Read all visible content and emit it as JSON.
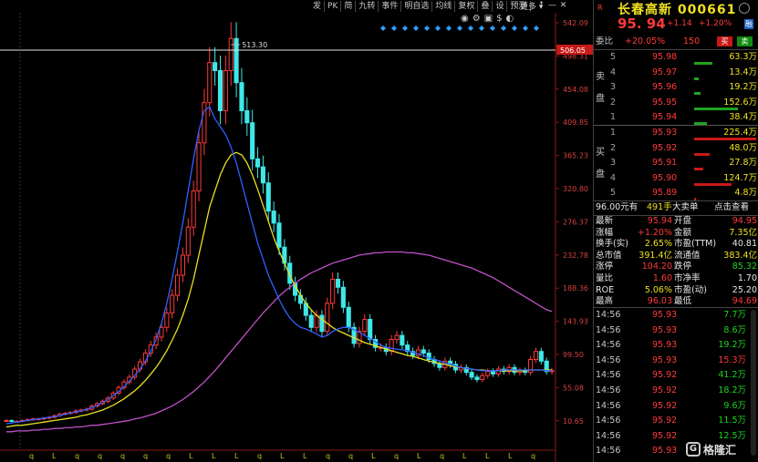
{
  "toolbar": {
    "items": [
      "发",
      "PK",
      "简",
      "九转",
      "事件",
      "明自选",
      "均线",
      "复权",
      "叠",
      "设",
      "预测"
    ],
    "more": "更多",
    "icons": [
      "eye-icon",
      "gear-icon",
      "lock-icon",
      "dollar-icon",
      "bell-icon"
    ],
    "window_controls": [
      "↑",
      "—",
      "✕"
    ]
  },
  "stock": {
    "badge": "R",
    "name": "长春高新 000661",
    "price": "95. 94",
    "change": "+1.14",
    "change_pct": "+1.20%",
    "margin_badge": "融",
    "weibi_label": "委比",
    "weibi_value": "+20.05%",
    "weibi_diff": "150",
    "buy_btn": "买",
    "sell_btn": "卖"
  },
  "order_book": {
    "sell_label": "卖\n盘",
    "buy_label": "买\n盘",
    "asks": [
      {
        "idx": "5",
        "price": "95.98",
        "vol": "63.3万",
        "bar": 0.3
      },
      {
        "idx": "4",
        "price": "95.97",
        "vol": "13.4万",
        "bar": 0.08
      },
      {
        "idx": "3",
        "price": "95.96",
        "vol": "19.2万",
        "bar": 0.1
      },
      {
        "idx": "2",
        "price": "95.95",
        "vol": "152.6万",
        "bar": 0.7
      },
      {
        "idx": "1",
        "price": "95.94",
        "vol": "38.4万",
        "bar": 0.2
      }
    ],
    "bids": [
      {
        "idx": "1",
        "price": "95.93",
        "vol": "225.4万",
        "bar": 1.0
      },
      {
        "idx": "2",
        "price": "95.92",
        "vol": "48.0万",
        "bar": 0.25
      },
      {
        "idx": "3",
        "price": "95.91",
        "vol": "27.8万",
        "bar": 0.15
      },
      {
        "idx": "4",
        "price": "95.90",
        "vol": "124.7万",
        "bar": 0.6
      },
      {
        "idx": "5",
        "price": "95.89",
        "vol": "4.8万",
        "bar": 0.03
      }
    ]
  },
  "big_order": {
    "label_price": "96.00元有",
    "qty": "491手",
    "type": "大卖单",
    "link": "点击查看"
  },
  "quote": [
    {
      "l1": "最新",
      "v1": "95.94",
      "c1": "red",
      "l2": "开盘",
      "v2": "94.95",
      "c2": "red"
    },
    {
      "l1": "涨幅",
      "v1": "+1.20%",
      "c1": "red",
      "l2": "金额",
      "v2": "7.35亿",
      "c2": "yellow"
    },
    {
      "l1": "换手(实)",
      "v1": "2.65%",
      "c1": "yellow",
      "l2": "市盈(TTM)",
      "v2": "40.81",
      "c2": "white"
    },
    {
      "l1": "总市值",
      "v1": "391.4亿",
      "c1": "yellow",
      "l2": "流通值",
      "v2": "383.4亿",
      "c2": "yellow"
    },
    {
      "l1": "涨停",
      "v1": "104.20",
      "c1": "red",
      "l2": "跌停",
      "v2": "85.32",
      "c2": "green"
    },
    {
      "l1": "量比",
      "v1": "1.60",
      "c1": "red",
      "l2": "市净率",
      "v2": "1.70",
      "c2": "white"
    },
    {
      "l1": "ROE",
      "v1": "5.06%",
      "c1": "yellow",
      "l2": "市盈(动)",
      "v2": "25.20",
      "c2": "white"
    },
    {
      "l1": "最高",
      "v1": "96.03",
      "c1": "red",
      "l2": "最低",
      "v2": "94.69",
      "c2": "red"
    }
  ],
  "ticks": [
    {
      "time": "14:56",
      "price": "95.93",
      "vol": "7.7万",
      "vc": "green",
      "dir": "↓",
      "dc": "green"
    },
    {
      "time": "14:56",
      "price": "95.93",
      "vol": "8.6万",
      "vc": "green",
      "dir": "↓",
      "dc": "green"
    },
    {
      "time": "14:56",
      "price": "95.93",
      "vol": "19.2万",
      "vc": "green",
      "dir": "↓",
      "dc": "green"
    },
    {
      "time": "14:56",
      "price": "95.93",
      "vol": "15.3万",
      "vc": "red",
      "dir": "↑",
      "dc": "red"
    },
    {
      "time": "14:56",
      "price": "95.92",
      "vol": "41.2万",
      "vc": "green",
      "dir": "↓",
      "dc": "green"
    },
    {
      "time": "14:56",
      "price": "95.92",
      "vol": "18.2万",
      "vc": "green",
      "dir": "↓",
      "dc": "green"
    },
    {
      "time": "14:56",
      "price": "95.92",
      "vol": "9.6万",
      "vc": "green",
      "dir": "↓",
      "dc": "green"
    },
    {
      "time": "14:56",
      "price": "95.92",
      "vol": "11.5万",
      "vc": "green",
      "dir": "↓",
      "dc": "green"
    },
    {
      "time": "14:56",
      "price": "95.92",
      "vol": "12.5万",
      "vc": "green",
      "dir": "↓",
      "dc": "green"
    },
    {
      "time": "14:56",
      "price": "95.93",
      "vol": "",
      "vc": "green",
      "dir": "",
      "dc": "green"
    }
  ],
  "watermark": {
    "logo": "G",
    "text": "格隆汇"
  },
  "chart_data": {
    "type": "candlestick",
    "y_ticks": [
      "542.09",
      "498.31",
      "454.08",
      "409.85",
      "365.23",
      "320.80",
      "276.37",
      "232.78",
      "188.36",
      "143.93",
      "99.50",
      "55.08",
      "10.65"
    ],
    "y_range": [
      10.65,
      542.09
    ],
    "max_label": "513.30",
    "crosshair_price": "506.05",
    "bottom_markers": [
      "q",
      "L",
      "q",
      "q",
      "q",
      "q",
      "q",
      "L",
      "L",
      "L",
      "q",
      "L",
      "L",
      "q",
      "q",
      "L",
      "q",
      "L",
      "q",
      "L",
      "L",
      "L",
      "q"
    ],
    "close": [
      34,
      33,
      33,
      34,
      35,
      36,
      36,
      37,
      38,
      40,
      42,
      43,
      44,
      46,
      47,
      48,
      52,
      55,
      58,
      62,
      68,
      75,
      82,
      88,
      98,
      107,
      118,
      128,
      138,
      150,
      168,
      190,
      215,
      240,
      275,
      320,
      380,
      430,
      480,
      470,
      420,
      470,
      510,
      455,
      420,
      405,
      360,
      350,
      330,
      295,
      280,
      250,
      230,
      205,
      190,
      180,
      165,
      150,
      165,
      145,
      180,
      210,
      200,
      175,
      150,
      130,
      145,
      160,
      135,
      125,
      125,
      120,
      135,
      140,
      128,
      120,
      115,
      122,
      118,
      110,
      105,
      100,
      108,
      104,
      97,
      100,
      94,
      88,
      85,
      90,
      95,
      92,
      98,
      95,
      100,
      94,
      96,
      94,
      110,
      120,
      108,
      95,
      96
    ],
    "ma_blue": [
      30,
      31,
      32,
      33,
      34,
      35,
      36,
      37,
      38,
      39,
      40,
      42,
      43,
      45,
      46,
      48,
      50,
      53,
      56,
      60,
      65,
      70,
      76,
      83,
      90,
      98,
      108,
      120,
      135,
      155,
      180,
      210,
      245,
      280,
      320,
      360,
      395,
      420,
      425,
      410,
      400,
      390,
      375,
      355,
      330,
      305,
      280,
      255,
      235,
      215,
      200,
      185,
      172,
      162,
      155,
      150,
      148,
      145,
      142,
      138,
      140,
      145,
      148,
      150,
      150,
      147,
      144,
      140,
      136,
      132,
      128,
      125,
      124,
      123,
      122,
      121,
      119,
      117,
      115,
      112,
      110,
      108,
      106,
      104,
      102,
      100,
      99,
      98,
      97,
      96,
      96,
      96,
      96,
      97,
      97,
      97,
      97,
      97,
      97,
      97,
      97,
      96,
      96
    ],
    "ma_yellow": [
      26,
      27,
      28,
      28,
      29,
      30,
      31,
      32,
      33,
      34,
      35,
      36,
      37,
      38,
      40,
      41,
      43,
      45,
      47,
      50,
      53,
      57,
      61,
      66,
      71,
      77,
      84,
      92,
      100,
      110,
      121,
      134,
      148,
      165,
      185,
      210,
      240,
      270,
      300,
      320,
      340,
      355,
      365,
      368,
      365,
      355,
      340,
      322,
      302,
      282,
      262,
      245,
      230,
      215,
      202,
      190,
      180,
      172,
      165,
      160,
      155,
      150,
      146,
      143,
      140,
      137,
      134,
      131,
      129,
      127,
      125,
      123,
      121,
      119,
      117,
      115,
      114,
      112,
      110,
      108,
      107,
      105,
      104,
      102,
      101,
      100,
      99,
      98,
      97,
      97,
      96,
      96,
      96,
      96,
      96,
      96,
      96,
      96,
      97,
      97,
      97,
      97,
      97
    ],
    "ma_purple": [
      20,
      20,
      21,
      21,
      21,
      22,
      22,
      23,
      23,
      24,
      24,
      25,
      25,
      26,
      26,
      27,
      28,
      28,
      29,
      30,
      31,
      32,
      33,
      34,
      36,
      37,
      39,
      41,
      43,
      46,
      49,
      52,
      56,
      60,
      65,
      70,
      76,
      82,
      89,
      96,
      104,
      112,
      120,
      128,
      136,
      144,
      152,
      160,
      168,
      175,
      182,
      189,
      195,
      200,
      205,
      210,
      214,
      218,
      221,
      224,
      227,
      230,
      232,
      234,
      236,
      238,
      240,
      241,
      242,
      243,
      243,
      244,
      244,
      244,
      244,
      243,
      243,
      242,
      241,
      240,
      238,
      236,
      234,
      232,
      230,
      228,
      226,
      224,
      221,
      218,
      215,
      212,
      208,
      204,
      200,
      196,
      192,
      188,
      184,
      180,
      176,
      172,
      170
    ]
  }
}
